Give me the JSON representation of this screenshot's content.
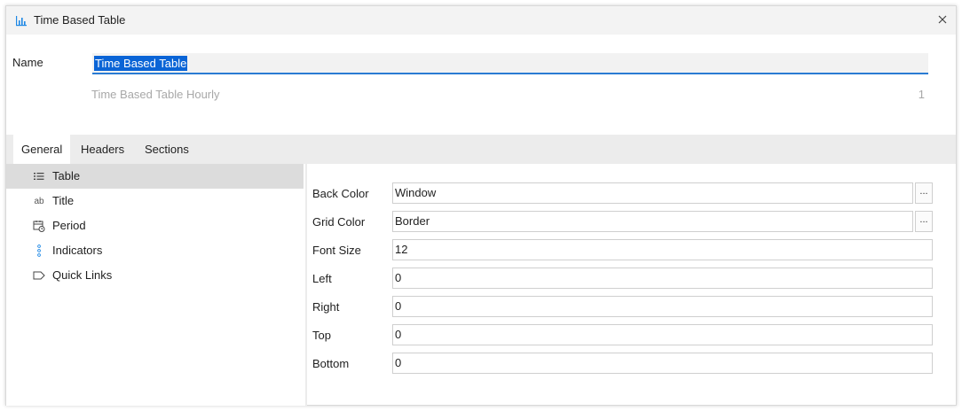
{
  "window": {
    "title": "Time Based Table",
    "app_icon": "bar-chart-icon",
    "close_icon": "close-icon"
  },
  "name_field": {
    "label": "Name",
    "value": "Time Based Table"
  },
  "subtitle": "Time Based Table Hourly",
  "counter": "1",
  "tabs": [
    {
      "label": "General",
      "active": true
    },
    {
      "label": "Headers",
      "active": false
    },
    {
      "label": "Sections",
      "active": false
    }
  ],
  "nav": [
    {
      "label": "Table",
      "icon": "list-icon",
      "selected": true
    },
    {
      "label": "Title",
      "icon": "ab-text-icon",
      "selected": false
    },
    {
      "label": "Period",
      "icon": "calendar-clock-icon",
      "selected": false
    },
    {
      "label": "Indicators",
      "icon": "dots-vertical-icon",
      "selected": false
    },
    {
      "label": "Quick Links",
      "icon": "tag-icon",
      "selected": false
    }
  ],
  "nav_icon_text": {
    "ab": "ab"
  },
  "properties": [
    {
      "label": "Back Color",
      "value": "Window",
      "button": "..."
    },
    {
      "label": "Grid Color",
      "value": "Border",
      "button": "..."
    },
    {
      "label": "Font Size",
      "value": "12"
    },
    {
      "label": "Left",
      "value": "0"
    },
    {
      "label": "Right",
      "value": "0"
    },
    {
      "label": "Top",
      "value": "0"
    },
    {
      "label": "Bottom",
      "value": "0"
    }
  ],
  "colors": {
    "accent": "#2a7bd3",
    "selection": "#0a64d6",
    "icon_blue": "#1e88e5"
  }
}
